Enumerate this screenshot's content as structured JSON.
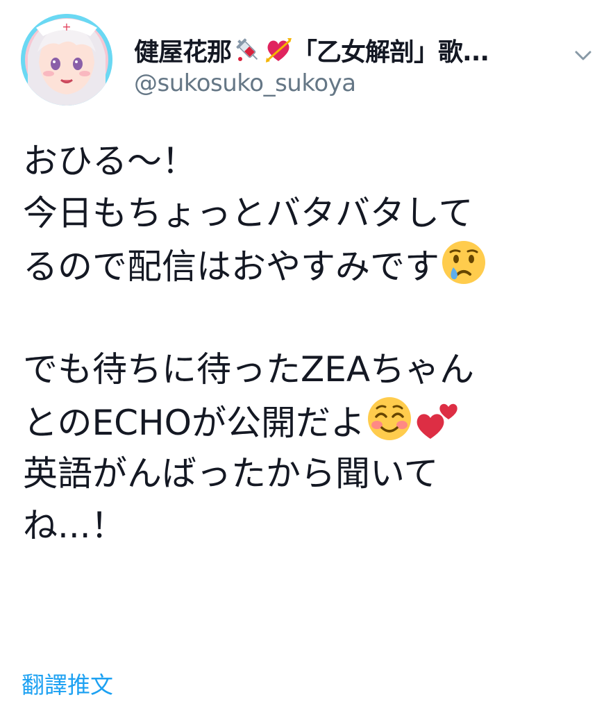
{
  "tweet": {
    "author": {
      "display_name": "健屋花那",
      "name_emojis": [
        "syringe-icon",
        "heart-with-arrow-icon"
      ],
      "name_suffix": "「乙女解剖」歌...",
      "handle": "@sukosuko_sukoya"
    },
    "menu_icon": "chevron-down-icon",
    "text_lines": [
      "おひる〜！",
      "今日もちょっとバタバタして",
      "るので配信はおやすみです",
      "",
      "でも待ちに待ったZEAちゃん",
      "とのECHOが公開だよ",
      "英語がんばったから聞いて",
      "ね...！"
    ],
    "inline_emojis": {
      "line_3": "crying-face-icon",
      "line_6": [
        "smiling-face-icon",
        "two-hearts-icon"
      ]
    },
    "translate_label": "翻譯推文"
  },
  "colors": {
    "text": "#141823",
    "secondary": "#657786",
    "link": "#1da1f2",
    "avatar_ring": "#6ad8f3"
  }
}
